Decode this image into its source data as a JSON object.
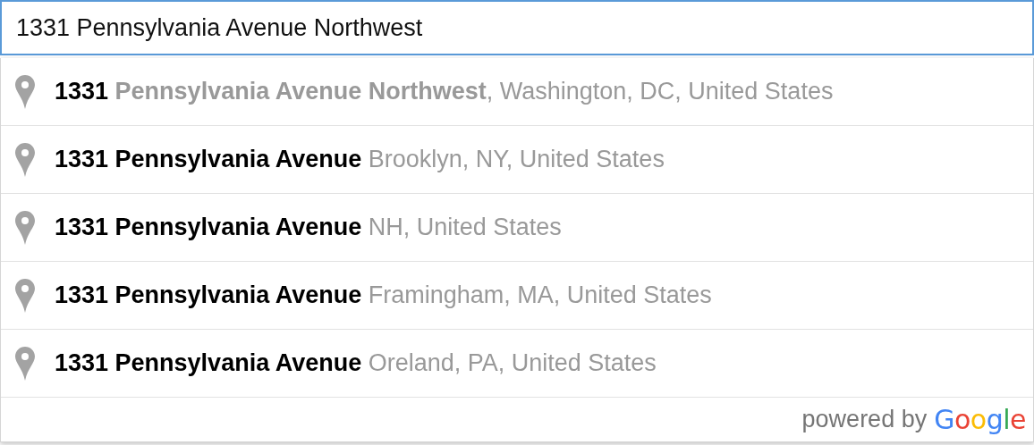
{
  "search": {
    "value": "1331 Pennsylvania Avenue Northwest"
  },
  "suggestions": [
    {
      "matched": "1331",
      "unmatched": "Pennsylvania Avenue Northwest",
      "secondary": ", Washington, DC, United States"
    },
    {
      "matched": "1331 Pennsylvania Avenue",
      "secondary": "Brooklyn, NY, United States"
    },
    {
      "matched": "1331 Pennsylvania Avenue",
      "secondary": "NH, United States"
    },
    {
      "matched": "1331 Pennsylvania Avenue",
      "secondary": "Framingham, MA, United States"
    },
    {
      "matched": "1331 Pennsylvania Avenue",
      "secondary": "Oreland, PA, United States"
    }
  ],
  "attribution": {
    "prefix": "powered by",
    "logo": "Google"
  }
}
